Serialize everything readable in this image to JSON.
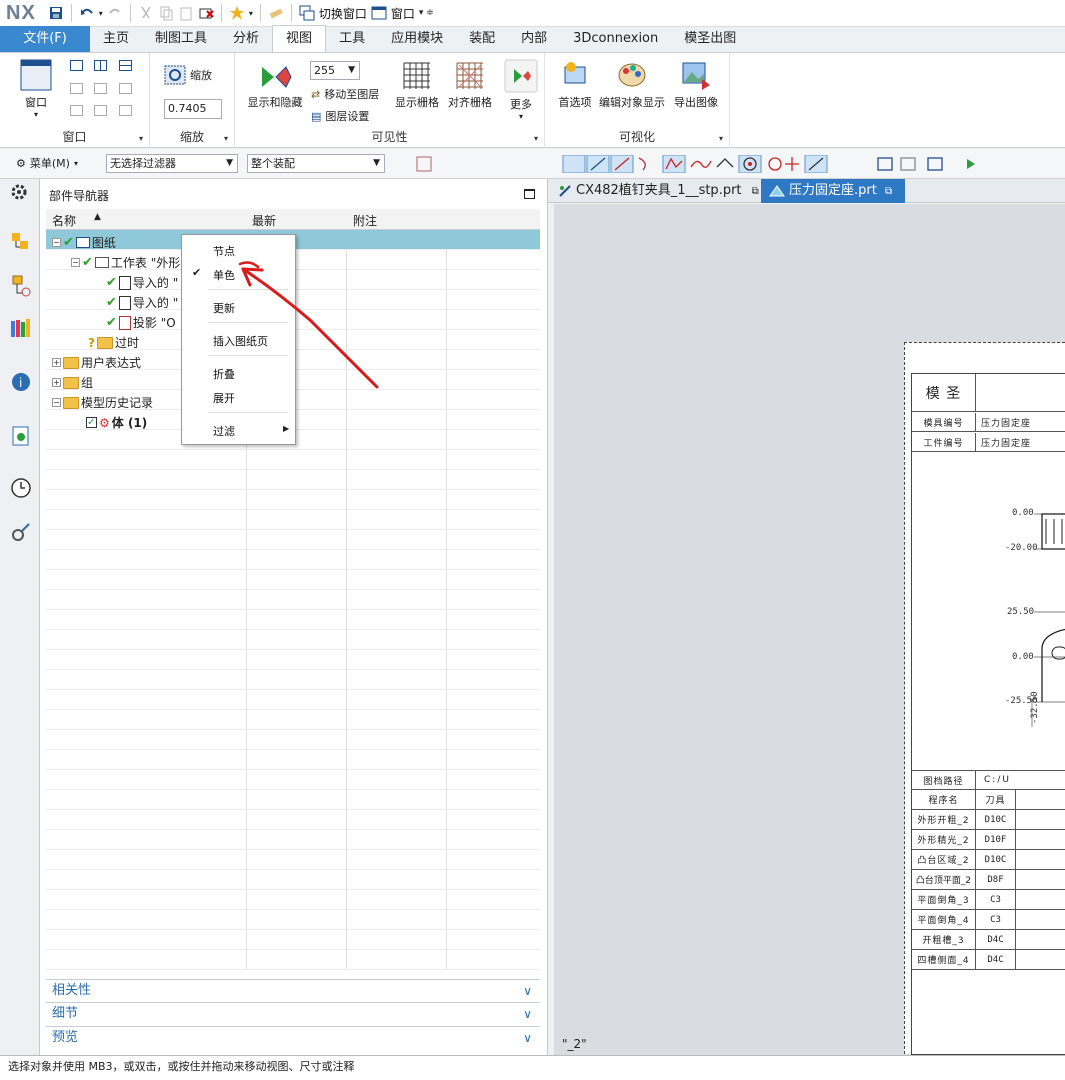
{
  "app": {
    "logo": "NX"
  },
  "qat": {
    "switch_window": "切换窗口",
    "window": "窗口"
  },
  "tabs": [
    "文件(F)",
    "主页",
    "制图工具",
    "分析",
    "视图",
    "工具",
    "应用模块",
    "装配",
    "内部",
    "3Dconnexion",
    "模圣出图"
  ],
  "active_tab": "视图",
  "ribbon": {
    "window_group": {
      "label": "窗口",
      "button": "窗口"
    },
    "zoom_group": {
      "label": "缩放",
      "button": "缩放",
      "value": "0.7405"
    },
    "visibility_group": {
      "label": "可见性",
      "show_hide": "显示和隐藏",
      "layer_value": "255",
      "move_to_layer": "移动至图层",
      "layer_settings": "图层设置",
      "show_grid": "显示栅格",
      "align_grid": "对齐栅格",
      "more": "更多"
    },
    "visual_group": {
      "label": "可视化",
      "preferences": "首选项",
      "edit_object_display": "编辑对象显示",
      "export_image": "导出图像"
    }
  },
  "toolbar2": {
    "menu": "菜单(M)",
    "filter": "无选择过滤器",
    "assembly": "整个装配"
  },
  "navigator": {
    "title": "部件导航器",
    "columns": [
      "名称",
      "最新",
      "附注"
    ],
    "nodes": [
      {
        "label": "图纸"
      },
      {
        "label": "工作表 \"外形"
      },
      {
        "label": "导入的 \""
      },
      {
        "label": "导入的 \""
      },
      {
        "label": "投影 \"O"
      },
      {
        "label": "过时"
      },
      {
        "label": "用户表达式"
      },
      {
        "label": "组"
      },
      {
        "label": "模型历史记录"
      },
      {
        "label": "体 (1)"
      }
    ],
    "accordions": [
      "相关性",
      "细节",
      "预览"
    ]
  },
  "context_menu": {
    "items": [
      "节点",
      "单色",
      "更新",
      "插入图纸页",
      "折叠",
      "展开",
      "过滤"
    ],
    "checked": "单色"
  },
  "graphics_tabs": [
    {
      "label": "CX482植钉夹具_1__stp.prt"
    },
    {
      "label": "压力固定座.prt"
    }
  ],
  "drawing": {
    "title": "模 圣",
    "rows": [
      {
        "key": "模具编号",
        "value": "压力固定座"
      },
      {
        "key": "工件编号",
        "value": "压力固定座"
      }
    ],
    "dims": [
      "0.00",
      "-20.00",
      "25.50",
      "0.00",
      "-25.50",
      "-32.50"
    ],
    "path_label": "图档路径",
    "path_value": "C:/U",
    "table_header": [
      "程序名",
      "刀具"
    ],
    "ops": [
      [
        "外形开粗_2",
        "D10C"
      ],
      [
        "外形精光_2",
        "D10F"
      ],
      [
        "凸台区域_2",
        "D10C"
      ],
      [
        "凸台顶平面_2",
        "D8F"
      ],
      [
        "平面倒角_3",
        "C3"
      ],
      [
        "平面倒角_4",
        "C3"
      ],
      [
        "开粗槽_3",
        "D4C"
      ],
      [
        "四槽侧面_4",
        "D4C"
      ]
    ],
    "sheet_label": "\"_2\""
  },
  "status": "选择对象并使用 MB3，或双击，或按住并拖动来移动视图、尺寸或注释",
  "colors": {
    "file_tab": "#3a89d0",
    "selection": "#8fc8d8",
    "active_doc_tab": "#2e78c4",
    "annotation": "#d81c1c"
  }
}
